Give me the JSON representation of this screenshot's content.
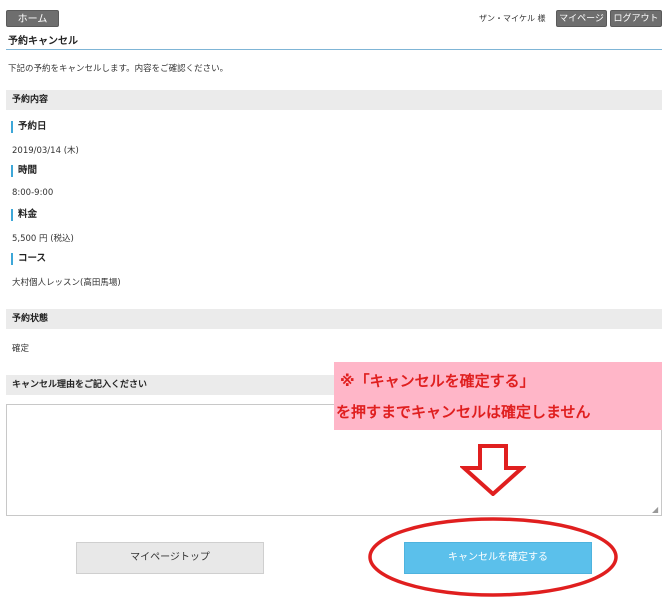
{
  "header": {
    "home_label": "ホーム",
    "user_name": "ザン・マイケル 様",
    "mypage_label": "マイページ",
    "logout_label": "ログアウト"
  },
  "page": {
    "title": "予約キャンセル",
    "intro": "下記の予約をキャンセルします。内容をご確認ください。"
  },
  "reservation": {
    "section_title": "予約内容",
    "fields": [
      {
        "label": "予約日",
        "value": "2019/03/14 (木)"
      },
      {
        "label": "時間",
        "value": "8:00-9:00"
      },
      {
        "label": "料金",
        "value": "5,500 円 (税込)"
      },
      {
        "label": "コース",
        "value": "大村個人レッスン(高田馬場)"
      }
    ]
  },
  "status": {
    "section_title": "予約状態",
    "value": "確定"
  },
  "reason": {
    "section_title": "キャンセル理由をご記入ください",
    "value": ""
  },
  "actions": {
    "mypage_top_label": "マイページトップ",
    "confirm_label": "キャンセルを確定する"
  },
  "annotation": {
    "line1": "※「キャンセルを確定する」",
    "line2": "を押すまでキャンセルは確定しません",
    "highlight_color": "#e01f1f",
    "box_color": "#ffb6c8"
  },
  "colors": {
    "accent": "#3da7d8",
    "confirm_button": "#5bc0eb",
    "header_button": "#6e6e6e"
  }
}
